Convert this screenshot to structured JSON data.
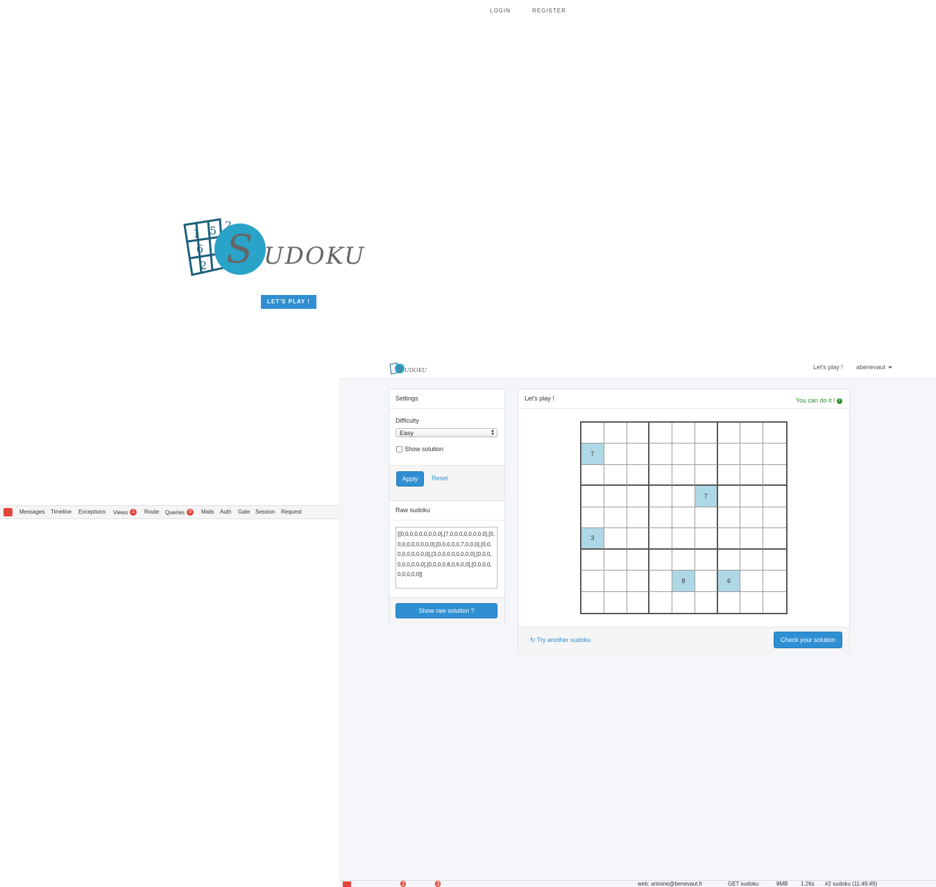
{
  "top_nav": {
    "login": "LOGIN",
    "register": "REGISTER"
  },
  "landing": {
    "logo_text": "SUDOKU",
    "logo_digits": [
      "1",
      "5",
      "2",
      "6",
      "2"
    ],
    "play_button": "LET'S PLAY !"
  },
  "debugbar": {
    "tabs": [
      {
        "label": "Messages"
      },
      {
        "label": "Timeline"
      },
      {
        "label": "Exceptions"
      },
      {
        "label": "Views",
        "badge": "1"
      },
      {
        "label": "Route"
      },
      {
        "label": "Queries",
        "badge": "0"
      },
      {
        "label": "Mails"
      },
      {
        "label": "Auth"
      },
      {
        "label": "Gate"
      },
      {
        "label": "Session"
      },
      {
        "label": "Request"
      }
    ]
  },
  "header": {
    "lets_play": "Let's play !",
    "user": "abenevaut"
  },
  "settings": {
    "title": "Settings",
    "difficulty_label": "Difficulty",
    "difficulty_value": "Easy",
    "show_solution": "Show solution",
    "apply": "Apply",
    "reset": "Reset"
  },
  "raw": {
    "title": "Raw sudoku",
    "text": "[[0,0,0,0,0,0,0,0,0],[7,0,0,0,0,0,0,0,0],[0,0,0,0,0,0,0,0,0],[0,0,0,0,0,7,0,0,0],[0,0,0,0,0,0,0,0,0],[3,0,0,0,0,0,0,0,0],[0,0,0,0,0,0,0,0,0],[0,0,0,0,8,0,6,0,0],[0,0,0,0,0,0,0,0,0]]",
    "button": "Show raw solution ?"
  },
  "game": {
    "title": "Let's play !",
    "status": "You can do it !",
    "grid": [
      [
        0,
        0,
        0,
        0,
        0,
        0,
        0,
        0,
        0
      ],
      [
        7,
        0,
        0,
        0,
        0,
        0,
        0,
        0,
        0
      ],
      [
        0,
        0,
        0,
        0,
        0,
        0,
        0,
        0,
        0
      ],
      [
        0,
        0,
        0,
        0,
        0,
        7,
        0,
        0,
        0
      ],
      [
        0,
        0,
        0,
        0,
        0,
        0,
        0,
        0,
        0
      ],
      [
        3,
        0,
        0,
        0,
        0,
        0,
        0,
        0,
        0
      ],
      [
        0,
        0,
        0,
        0,
        0,
        0,
        0,
        0,
        0
      ],
      [
        0,
        0,
        0,
        0,
        8,
        0,
        6,
        0,
        0
      ],
      [
        0,
        0,
        0,
        0,
        0,
        0,
        0,
        0,
        0
      ]
    ],
    "try_another": "Try another sudoku",
    "check": "Check your solution"
  },
  "statusbar": {
    "badge_a": "2",
    "badge_b": "3",
    "user": "web: antoine@benevaut.fr",
    "route": "GET sudoku",
    "memory": "8MB",
    "time": "1.26s",
    "request": "#2 sudoku (11:49:49)"
  },
  "colors": {
    "accent": "#2f8fd2",
    "given_cell": "#aed8e6",
    "success": "#2d8a2d",
    "logo_dark": "#1b5f7a",
    "logo_circle": "#2aa3c9"
  }
}
